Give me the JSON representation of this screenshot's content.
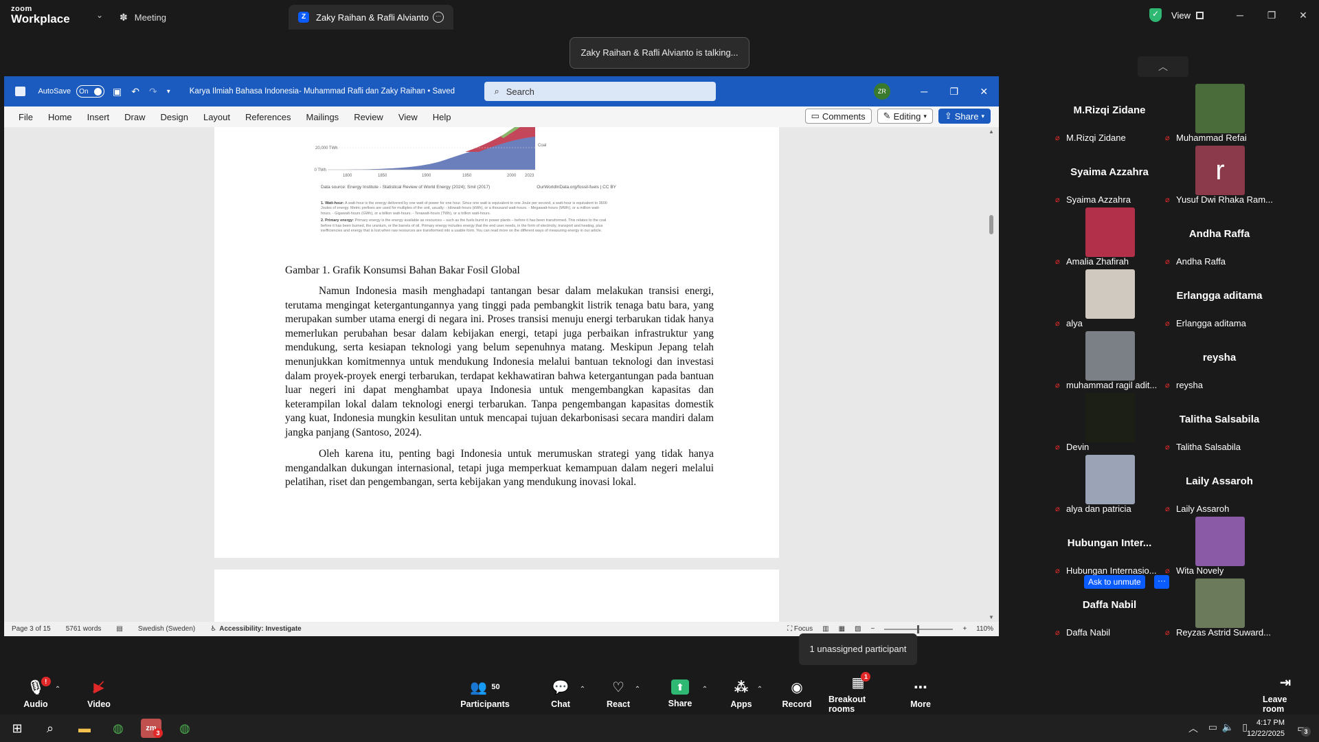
{
  "zoom": {
    "logo_top": "zoom",
    "logo_bottom": "Workplace",
    "tabs": [
      {
        "label": "Meeting"
      },
      {
        "label": "Zaky Raihan & Rafli Alvianto's scr"
      }
    ],
    "view_label": "View",
    "talking_banner": "Zaky Raihan & Rafli Alvianto is talking...",
    "unassigned_tip": "1 unassigned participant",
    "participants_count": "50",
    "toolbar": [
      {
        "label": "Audio"
      },
      {
        "label": "Video"
      },
      {
        "label": "Participants"
      },
      {
        "label": "Chat"
      },
      {
        "label": "React"
      },
      {
        "label": "Share"
      },
      {
        "label": "Apps"
      },
      {
        "label": "Record"
      },
      {
        "label": "Breakout rooms"
      },
      {
        "label": "More"
      },
      {
        "label": "Leave room"
      }
    ],
    "breakout_badge": "1",
    "ask_to_unmute": "Ask to unmute",
    "ask_more": "···"
  },
  "word": {
    "autosave_label": "AutoSave",
    "toggle_label": "On",
    "doc_title": "Karya Ilmiah Bahasa Indonesia- Muhammad Rafli dan Zaky Raihan • Saved",
    "search_placeholder": "Search",
    "avatar_initials": "ZR",
    "menu": [
      "File",
      "Home",
      "Insert",
      "Draw",
      "Design",
      "Layout",
      "References",
      "Mailings",
      "Review",
      "View",
      "Help"
    ],
    "comments_btn": "Comments",
    "editing_btn": "Editing",
    "share_btn": "Share",
    "figure": {
      "y_labels": [
        "20,000 TWh",
        "0 TWh"
      ],
      "x_labels": [
        "1800",
        "1850",
        "1900",
        "1950",
        "2000",
        "2023"
      ],
      "series_label": "Coal",
      "source_left": "Data source: Energy Institute - Statistical Review of World Energy (2024); Smil (2017)",
      "source_right": "OurWorldInData.org/fossil-fuels | CC BY",
      "note1_title": "1. Watt-hour:",
      "note1_text": "A watt-hour is the energy delivered by one watt of power for one hour. Since one watt is equivalent to one Joule per second, a watt-hour is equivalent to 3600 Joules of energy. Metric prefixes are used for multiples of the unit, usually: - kilowatt-hours (kWh), or a thousand watt-hours. - Megawatt-hours (MWh), or a million watt-hours. - Gigawatt-hours (GWh), or a billion watt-hours. - Terawatt-hours (TWh), or a trillion watt-hours.",
      "note2_title": "2. Primary energy:",
      "note2_text": "Primary energy is the energy available as resources – such as the fuels burnt in power plants – before it has been transformed. This relates to the coal before it has been burned, the uranium, or the barrels of oil. Primary energy includes energy that the end user needs, in the form of electricity, transport and heating, plus inefficiencies and energy that is lost when raw resources are transformed into a usable form. You can read more on the different ways of measuring energy in our article."
    },
    "caption": "Gambar 1. Grafik Konsumsi Bahan Bakar Fosil Global",
    "para1": "Namun Indonesia masih menghadapi tantangan besar dalam melakukan transisi energi, terutama mengingat ketergantungannya yang tinggi pada pembangkit listrik tenaga batu bara, yang merupakan sumber utama energi di negara ini. Proses transisi menuju energi terbarukan tidak hanya memerlukan perubahan besar dalam kebijakan energi, tetapi juga perbaikan infrastruktur yang mendukung, serta kesiapan teknologi yang belum sepenuhnya matang. Meskipun Jepang telah menunjukkan komitmennya untuk mendukung Indonesia melalui bantuan teknologi dan investasi dalam proyek-proyek energi terbarukan, terdapat kekhawatiran bahwa ketergantungan pada bantuan luar negeri ini dapat menghambat upaya Indonesia untuk mengembangkan kapasitas dan keterampilan lokal dalam teknologi energi terbarukan. Tanpa pengembangan kapasitas domestik yang kuat, Indonesia mungkin kesulitan untuk mencapai tujuan dekarbonisasi secara mandiri dalam jangka panjang (Santoso, 2024).",
    "para2": "Oleh karena itu, penting bagi Indonesia untuk merumuskan strategi yang tidak hanya mengandalkan dukungan internasional, tetapi juga memperkuat kemampuan dalam negeri melalui pelatihan, riset dan pengembangan, serta kebijakan yang mendukung inovasi lokal.",
    "status": {
      "page": "Page 3 of 15",
      "words": "5761 words",
      "language": "Swedish (Sweden)",
      "accessibility": "Accessibility: Investigate",
      "focus": "Focus",
      "zoom": "110%"
    }
  },
  "gallery": [
    {
      "label": "M.Rizqi Zidane",
      "name": "M.Rizqi Zidane",
      "photo": false
    },
    {
      "label": "Muhammad Refai",
      "photo": true,
      "color": "#4a6b3a"
    },
    {
      "label": "Syaima Azzahra",
      "name": "Syaima Azzahra",
      "photo": false
    },
    {
      "label": "Yusuf Dwi Rhaka Ram...",
      "photo": true,
      "color": "#8a3a4a",
      "letter": "r"
    },
    {
      "label": "Amalia Zhafirah",
      "photo": true,
      "color": "#b2304a"
    },
    {
      "label": "Andha Raffa",
      "name": "Andha Raffa",
      "photo": false
    },
    {
      "label": "alya",
      "photo": true,
      "color": "#cfc9bf"
    },
    {
      "label": "Erlangga aditama",
      "name": "Erlangga aditama",
      "photo": false
    },
    {
      "label": "muhammad ragil adit...",
      "photo": true,
      "color": "#7b8087"
    },
    {
      "label": "reysha",
      "name": "reysha",
      "photo": false
    },
    {
      "label": "Devin",
      "photo": true,
      "color": "#1c1f16"
    },
    {
      "label": "Talitha Salsabila",
      "name": "Talitha Salsabila",
      "photo": false
    },
    {
      "label": "alya dan patricia",
      "photo": true,
      "color": "#9aa4b6"
    },
    {
      "label": "Laily Assaroh",
      "name": "Laily Assaroh",
      "photo": false
    },
    {
      "label": "Hubungan Internasio...",
      "name": "Hubungan  Inter...",
      "photo": false
    },
    {
      "label": "Wita Novely",
      "photo": true,
      "color": "#8a5aa6"
    },
    {
      "label": "Daffa Nabil",
      "name": "Daffa Nabil",
      "photo": false
    },
    {
      "label": "Reyzas Astrid Suward...",
      "photo": true,
      "color": "#6a7a5a"
    }
  ],
  "taskbar": {
    "time": "4:17 PM",
    "date": "12/22/2025",
    "notif_count": "3",
    "zoom_badge": "3"
  }
}
